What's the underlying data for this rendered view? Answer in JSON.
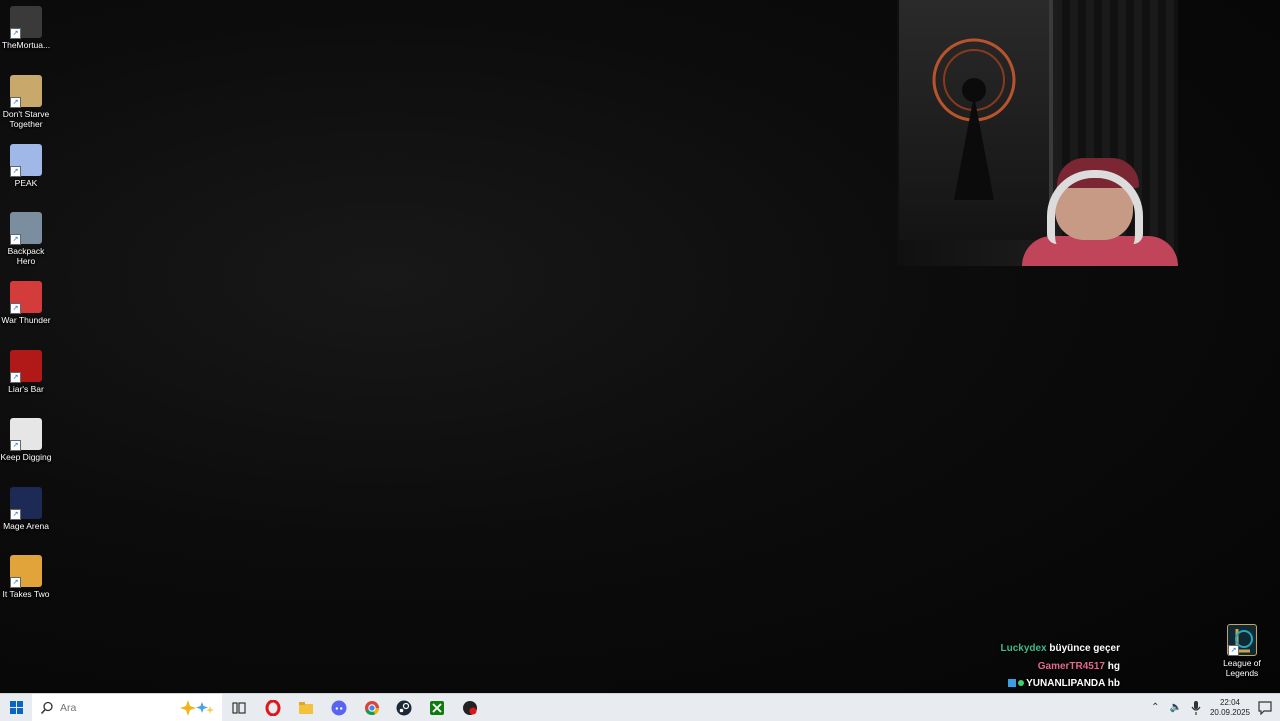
{
  "desktop": {
    "icons": [
      {
        "label": "TheMortua...",
        "icon": "themortuary-assistant-icon",
        "color": "#3a3a3a"
      },
      {
        "label": "Don't Starve Together",
        "icon": "dont-starve-together-icon",
        "color": "#c9a86b"
      },
      {
        "label": "PEAK",
        "icon": "peak-icon",
        "color": "#9fb8e8"
      },
      {
        "label": "Backpack Hero",
        "icon": "backpack-hero-icon",
        "color": "#7a8ea0"
      },
      {
        "label": "War Thunder",
        "icon": "war-thunder-icon",
        "color": "#d43c3c"
      },
      {
        "label": "Liar's Bar",
        "icon": "liars-bar-icon",
        "color": "#b11818"
      },
      {
        "label": "Keep Digging",
        "icon": "keep-digging-icon",
        "color": "#e6e6e6"
      },
      {
        "label": "Mage Arena",
        "icon": "mage-arena-icon",
        "color": "#1c2a55"
      },
      {
        "label": "It Takes Two",
        "icon": "it-takes-two-icon",
        "color": "#e0a43a"
      }
    ],
    "right_icon": {
      "label": "League of Legends",
      "icon": "league-of-legends-icon",
      "color": "#c8a554"
    }
  },
  "chat": [
    {
      "user": "Luckydex",
      "message": "büyünce geçer",
      "user_color": "#3dbb8a"
    },
    {
      "user": "GamerTR4517",
      "message": "hg",
      "user_color": "#e06a8a"
    },
    {
      "user": "YUNANLIPANDA",
      "message": "hb",
      "user_color": "#ffffff"
    }
  ],
  "taskbar": {
    "search_placeholder": "Ara",
    "pinned_apps": [
      "task-view-icon",
      "opera-icon",
      "file-explorer-icon",
      "discord-icon",
      "chrome-icon",
      "steam-icon",
      "xbox-icon",
      "riot-client-icon"
    ],
    "time": "22:04",
    "date": "20.09.2025"
  }
}
